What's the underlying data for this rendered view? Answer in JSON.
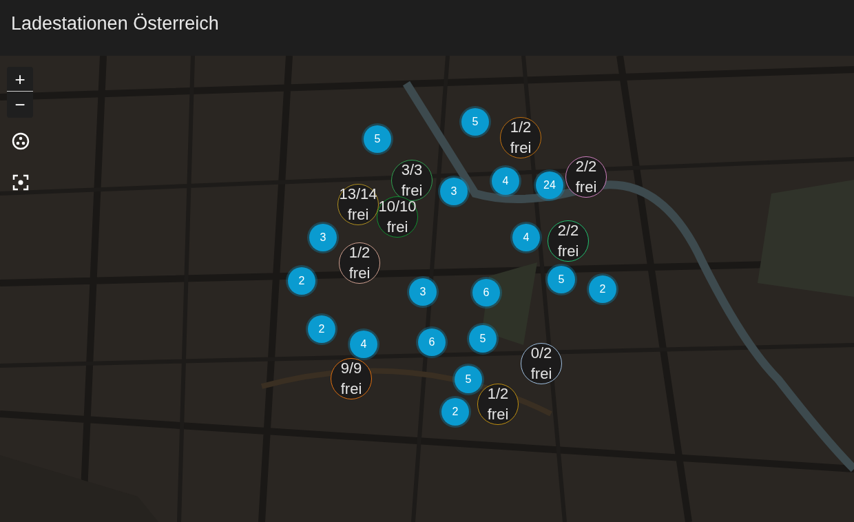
{
  "header": {
    "title": "Ladestationen Österreich"
  },
  "map": {
    "zoom_in": "+",
    "zoom_out": "−",
    "markers": [
      {
        "kind": "cluster",
        "count": "5"
      },
      {
        "kind": "cluster",
        "count": "5"
      },
      {
        "kind": "station",
        "count": "1/2",
        "label": "frei",
        "color": "#c07010"
      },
      {
        "kind": "station",
        "count": "3/3",
        "label": "frei",
        "color": "#30a050"
      },
      {
        "kind": "station",
        "count": "13/14",
        "label": "frei",
        "color": "#b09020"
      },
      {
        "kind": "station",
        "count": "10/10",
        "label": "frei",
        "color": "#109030"
      },
      {
        "kind": "cluster",
        "count": "3"
      },
      {
        "kind": "cluster",
        "count": "4"
      },
      {
        "kind": "cluster",
        "count": "24"
      },
      {
        "kind": "station",
        "count": "2/2",
        "label": "frei",
        "color": "#d080c0"
      },
      {
        "kind": "cluster",
        "count": "3"
      },
      {
        "kind": "station",
        "count": "1/2",
        "label": "frei",
        "color": "#d0a090"
      },
      {
        "kind": "cluster",
        "count": "4"
      },
      {
        "kind": "station",
        "count": "2/2",
        "label": "frei",
        "color": "#20c070"
      },
      {
        "kind": "cluster",
        "count": "2"
      },
      {
        "kind": "cluster",
        "count": "3"
      },
      {
        "kind": "cluster",
        "count": "6"
      },
      {
        "kind": "cluster",
        "count": "5"
      },
      {
        "kind": "cluster",
        "count": "2"
      },
      {
        "kind": "cluster",
        "count": "2"
      },
      {
        "kind": "cluster",
        "count": "4"
      },
      {
        "kind": "cluster",
        "count": "6"
      },
      {
        "kind": "cluster",
        "count": "5"
      },
      {
        "kind": "station",
        "count": "9/9",
        "label": "frei",
        "color": "#e07010"
      },
      {
        "kind": "cluster",
        "count": "5"
      },
      {
        "kind": "station",
        "count": "0/2",
        "label": "frei",
        "color": "#a0c0e0"
      },
      {
        "kind": "cluster",
        "count": "2"
      },
      {
        "kind": "station",
        "count": "1/2",
        "label": "frei",
        "color": "#c09010"
      }
    ]
  }
}
